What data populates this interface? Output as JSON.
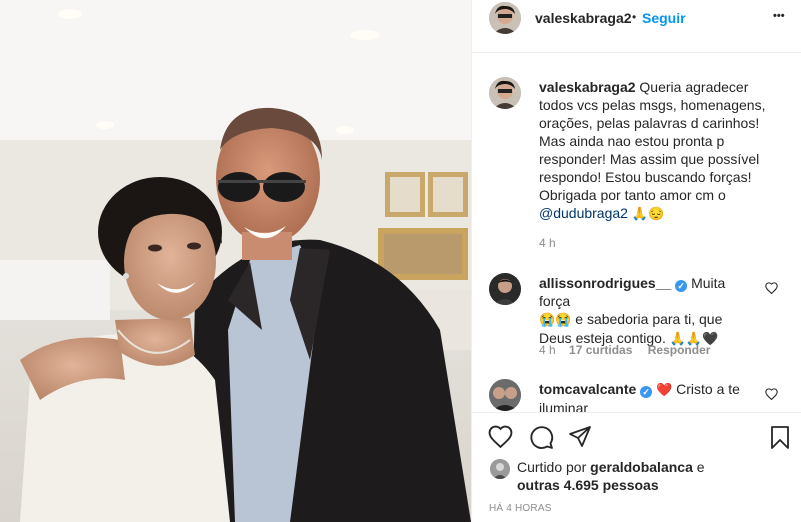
{
  "post": {
    "photo_alt": "Foto",
    "author": {
      "username": "valeskabraga2",
      "follow_label": "Seguir",
      "dot": "•"
    },
    "more_label": "•••"
  },
  "caption": {
    "username": "valeskabraga2",
    "text": "Queria agradecer todos vcs pelas msgs, homenagens, orações, pelas palavras d carinhos! Mas ainda nao estou pronta p responder! Mas assim que possível respondo! Estou buscando forças! Obrigada por tanto amor cm o",
    "mention": "@dudubraga2",
    "emojis": "🙏😔",
    "time": "4 h"
  },
  "comments": [
    {
      "username": "allissonrodrigues__",
      "line1": "Muita força",
      "line2_emojis": "😭😭",
      "line2": "e sabedoria para ti, que",
      "line3": "Deus esteja contigo.",
      "line3_emojis": "🙏🙏🖤",
      "time": "4 h",
      "likes": "17 curtidas",
      "reply_label": "Responder"
    },
    {
      "username": "tomcavalcante",
      "emoji": "❤️",
      "line1": "Cristo a te",
      "line2": "iluminar"
    }
  ],
  "likes": {
    "prefix": "Curtido por",
    "user": "geraldobalanca",
    "conj": "e",
    "others": "outras 4.695 pessoas"
  },
  "timestamp": "HÁ 4 HORAS",
  "colors": {
    "accent": "#0095f6",
    "verified": "#3897f0",
    "heart": "#ed4956"
  }
}
